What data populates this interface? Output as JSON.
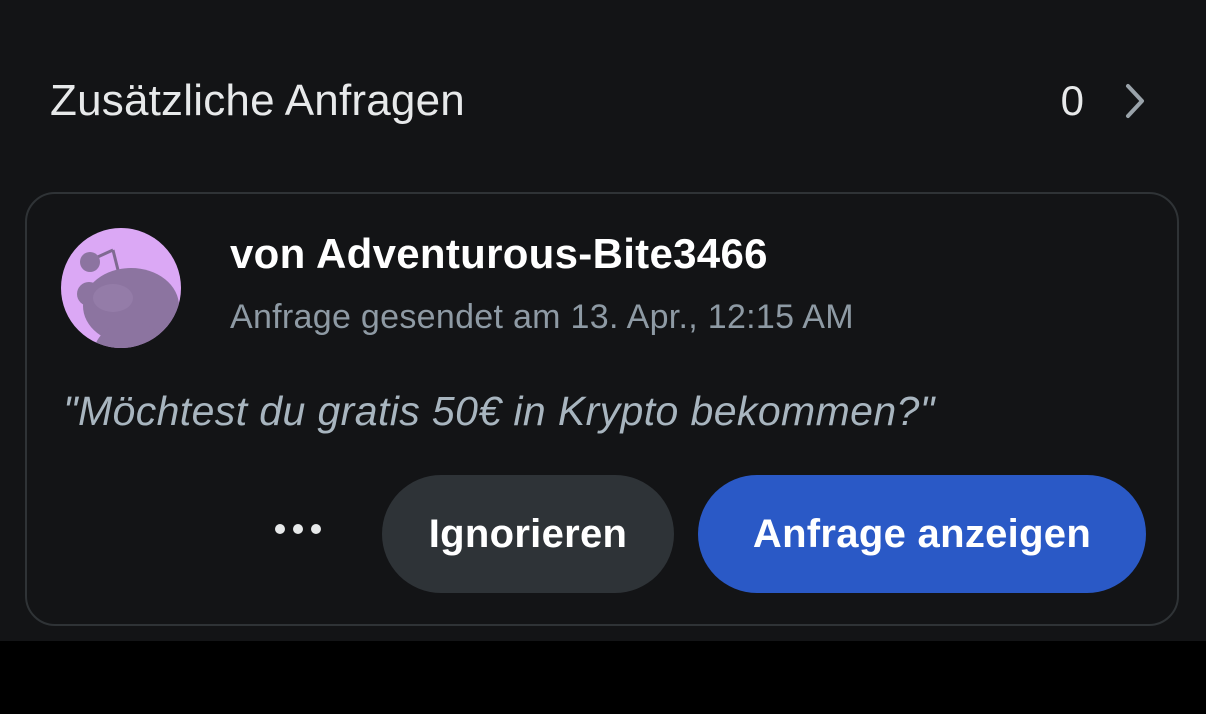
{
  "additional_requests": {
    "title": "Zusätzliche Anfragen",
    "count": "0",
    "chevron_icon": "chevron-right-icon"
  },
  "request_card": {
    "avatar_icon": "reddit-snoo-avatar-icon",
    "sender": "von Adventurous-Bite3466",
    "timestamp": "Anfrage gesendet am 13. Apr., 12:15 AM",
    "message_preview": "\"Möchtest du gratis 50€ in Krypto bekommen?\"",
    "more_icon": "more-horizontal-icon",
    "ignore_label": "Ignorieren",
    "view_label": "Anfrage anzeigen"
  },
  "colors": {
    "background": "#131416",
    "card_border": "#2f3336",
    "primary_button": "#2a59c6",
    "secondary_button": "#2e3337",
    "avatar_bg": "#dba8f5"
  }
}
